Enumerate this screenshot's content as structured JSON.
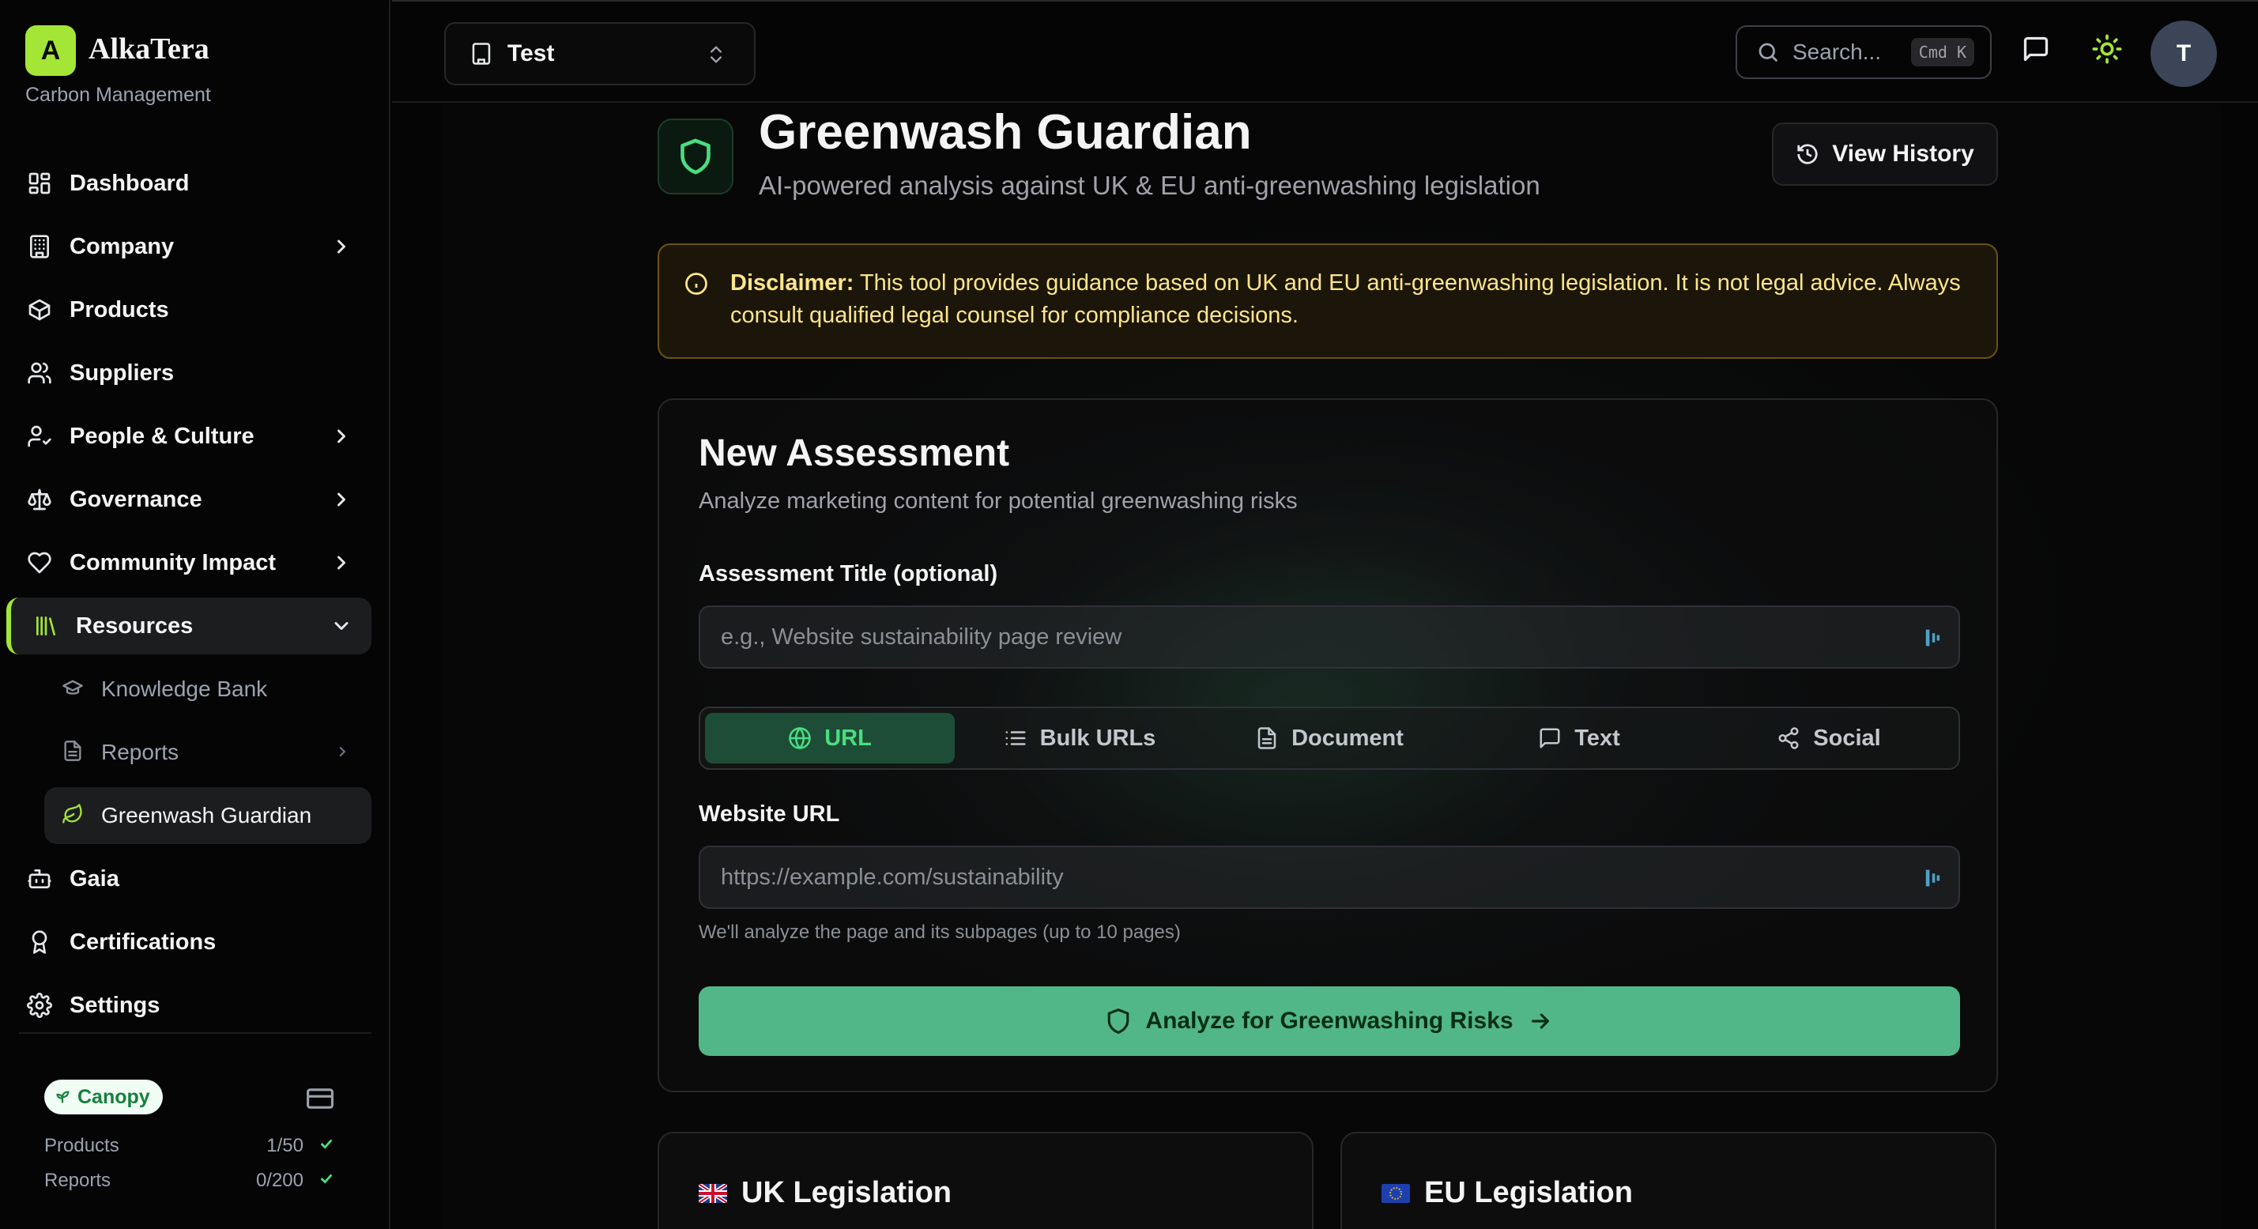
{
  "brand": {
    "logo_letter": "A",
    "name": "AlkaTera",
    "subtitle": "Carbon Management",
    "accent": "#a3e635"
  },
  "sidebar": {
    "items": [
      {
        "label": "Dashboard",
        "icon": "dashboard-grid-icon"
      },
      {
        "label": "Company",
        "icon": "building-icon",
        "has_submenu": true
      },
      {
        "label": "Products",
        "icon": "package-icon"
      },
      {
        "label": "Suppliers",
        "icon": "users-icon"
      },
      {
        "label": "People & Culture",
        "icon": "user-check-icon",
        "has_submenu": true
      },
      {
        "label": "Governance",
        "icon": "scale-icon",
        "has_submenu": true
      },
      {
        "label": "Community Impact",
        "icon": "heart-icon",
        "has_submenu": true
      },
      {
        "label": "Resources",
        "icon": "library-icon",
        "expanded": true,
        "active": true
      },
      {
        "label": "Gaia",
        "icon": "bot-icon"
      },
      {
        "label": "Certifications",
        "icon": "award-icon"
      },
      {
        "label": "Settings",
        "icon": "gear-icon"
      }
    ],
    "resources_sub": [
      {
        "label": "Knowledge Bank",
        "icon": "graduation-cap-icon"
      },
      {
        "label": "Reports",
        "icon": "file-icon",
        "has_submenu": true
      },
      {
        "label": "Greenwash Guardian",
        "icon": "leaf-icon",
        "current": true
      }
    ],
    "plan": {
      "badge": "Canopy",
      "rows": [
        {
          "label": "Products",
          "value": "1/50"
        },
        {
          "label": "Reports",
          "value": "0/200"
        }
      ]
    }
  },
  "topbar": {
    "org": "Test",
    "search_placeholder": "Search...",
    "search_shortcut": "Cmd K",
    "avatar_initial": "T"
  },
  "page": {
    "title": "Greenwash Guardian",
    "subtitle": "AI-powered analysis against UK & EU anti-greenwashing legislation",
    "history_button": "View History",
    "disclaimer_label": "Disclaimer:",
    "disclaimer_text": " This tool provides guidance based on UK and EU anti-greenwashing legislation. It is not legal advice. Always consult qualified legal counsel for compliance decisions."
  },
  "assessment": {
    "title": "New Assessment",
    "subtitle": "Analyze marketing content for potential greenwashing risks",
    "title_field_label": "Assessment Title (optional)",
    "title_field_placeholder": "e.g., Website sustainability page review",
    "tabs": [
      {
        "label": "URL",
        "icon": "globe-icon",
        "active": true
      },
      {
        "label": "Bulk URLs",
        "icon": "list-icon"
      },
      {
        "label": "Document",
        "icon": "document-icon"
      },
      {
        "label": "Text",
        "icon": "message-square-icon"
      },
      {
        "label": "Social",
        "icon": "share-icon"
      }
    ],
    "url_label": "Website URL",
    "url_placeholder": "https://example.com/sustainability",
    "url_hint": "We'll analyze the page and its subpages (up to 10 pages)",
    "analyze_button": "Analyze for Greenwashing Risks",
    "analyze_color": "#52b788"
  },
  "legislation": [
    {
      "title": "UK Legislation",
      "flag": "uk-flag-icon"
    },
    {
      "title": "EU Legislation",
      "flag": "eu-flag-icon"
    }
  ]
}
